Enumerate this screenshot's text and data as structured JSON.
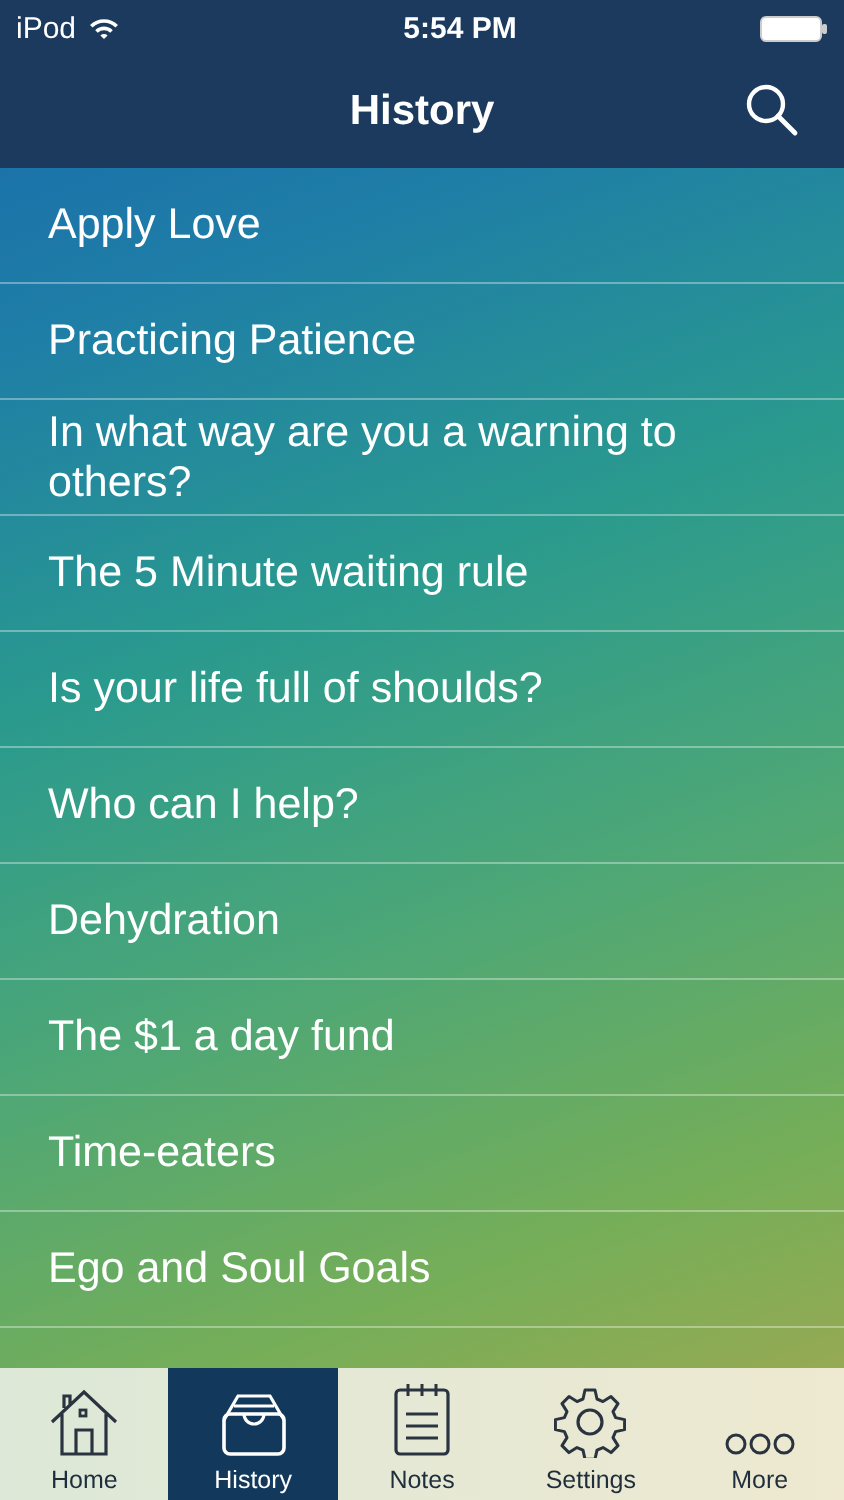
{
  "status_bar": {
    "carrier": "iPod",
    "time": "5:54 PM"
  },
  "nav_bar": {
    "title": "History"
  },
  "items": [
    "Apply Love",
    "Practicing Patience",
    "In what way are you a warning to others?",
    "The 5 Minute waiting rule",
    "Is your life full of shoulds?",
    "Who can I help?",
    "Dehydration",
    "The $1 a day fund",
    "Time-eaters",
    "Ego and Soul Goals"
  ],
  "tabs": [
    {
      "label": "Home",
      "kind": "home",
      "selected": false
    },
    {
      "label": "History",
      "kind": "history",
      "selected": true
    },
    {
      "label": "Notes",
      "kind": "notes",
      "selected": false
    },
    {
      "label": "Settings",
      "kind": "settings",
      "selected": false
    },
    {
      "label": "More",
      "kind": "more",
      "selected": false
    }
  ]
}
